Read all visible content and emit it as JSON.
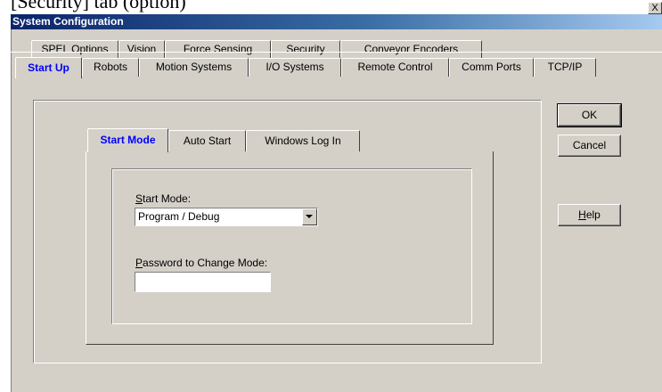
{
  "caption": "[Security] tab (option)",
  "window": {
    "title": "System Configuration",
    "close_symbol": "X"
  },
  "tabs_back_row": [
    "SPEL Options",
    "Vision",
    "Force Sensing",
    "Security",
    "Conveyor Encoders"
  ],
  "tabs_front_row": [
    "Start Up",
    "Robots",
    "Motion Systems",
    "I/O Systems",
    "Remote Control",
    "Comm Ports",
    "TCP/IP"
  ],
  "active_tab": "Start Up",
  "inner_tabs": [
    "Start Mode",
    "Auto Start",
    "Windows Log In"
  ],
  "active_inner_tab": "Start Mode",
  "form": {
    "start_mode_label_key": "S",
    "start_mode_label_rest": "tart Mode:",
    "start_mode_value": "Program / Debug",
    "password_label_key": "P",
    "password_label_rest": "assword to Change Mode:",
    "password_value": ""
  },
  "buttons": {
    "ok": "OK",
    "cancel": "Cancel",
    "help_key": "H",
    "help_rest": "elp"
  },
  "icons": {
    "dropdown": "chevron-down-icon",
    "close": "close-icon"
  },
  "colors": {
    "title_gradient_start": "#0a246a",
    "title_gradient_end": "#a6caf0",
    "active_tab_text": "#0000ff",
    "face": "#d4d0c8"
  }
}
